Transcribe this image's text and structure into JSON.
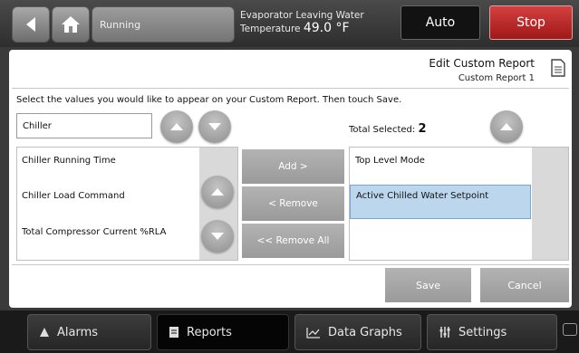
{
  "header": {
    "status": "Running",
    "evap_label": "Evaporator Leaving Water",
    "evap_temp_label": "Temperature",
    "evap_value": "49.0 °F",
    "auto_label": "Auto",
    "stop_label": "Stop"
  },
  "page": {
    "title": "Edit Custom Report",
    "subtitle": "Custom Report 1",
    "instructions": "Select the values you would like to appear on your Custom Report. Then touch Save."
  },
  "category": {
    "value": "Chiller"
  },
  "total": {
    "label": "Total Selected:",
    "count": "2"
  },
  "available": [
    "Chiller Running Time",
    "Chiller Load Command",
    "Total Compressor Current %RLA"
  ],
  "selected": [
    "Top Level Mode",
    "Active Chilled Water Setpoint"
  ],
  "actions": {
    "add": "Add >",
    "remove": "< Remove",
    "remove_all": "<< Remove All",
    "save": "Save",
    "cancel": "Cancel"
  },
  "tabs": [
    {
      "label": "Alarms",
      "icon": "alarm-icon"
    },
    {
      "label": "Reports",
      "icon": "report-icon"
    },
    {
      "label": "Data Graphs",
      "icon": "graph-icon"
    },
    {
      "label": "Settings",
      "icon": "settings-icon"
    }
  ],
  "colors": {
    "stop": "#b82424",
    "selected_row": "#bcd6ee",
    "panel": "#ffffff"
  }
}
